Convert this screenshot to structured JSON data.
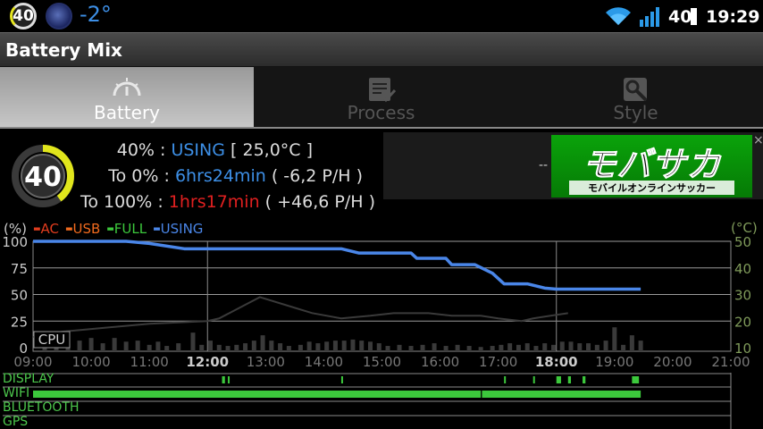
{
  "status_bar": {
    "battery_badge": "40",
    "temperature": "-2°",
    "battery_percent": "40",
    "clock": "19:29"
  },
  "app": {
    "title": "Battery Mix"
  },
  "tabs": [
    {
      "label": "Battery",
      "selected": true
    },
    {
      "label": "Process",
      "selected": false
    },
    {
      "label": "Style",
      "selected": false
    }
  ],
  "battery": {
    "gauge_value": "40",
    "level_fraction": 0.4,
    "line1": {
      "prefix": "40% : ",
      "value": "USING",
      "suffix": " [ 25,0°C ]"
    },
    "line2": {
      "prefix": "To 0% : ",
      "value": "6hrs24min",
      "suffix": " ( -6,2 P/H )"
    },
    "line3": {
      "prefix": "To 100% : ",
      "value": "1hrs17min",
      "suffix": " ( +46,6 P/H )"
    }
  },
  "ad": {
    "placeholder": "--",
    "title": "モバサカ",
    "subtitle": "モバイルオンラインサッカー",
    "close": "×"
  },
  "chart_data": {
    "type": "line",
    "left_unit": "(%)",
    "right_unit": "(°C)",
    "legend": [
      {
        "name": "AC",
        "color": "#e03c1e"
      },
      {
        "name": "USB",
        "color": "#f06a1e"
      },
      {
        "name": "FULL",
        "color": "#3cc83c"
      },
      {
        "name": "USING",
        "color": "#4a86e8"
      }
    ],
    "y_left_ticks": [
      "100",
      "75",
      "50",
      "25",
      "0"
    ],
    "y_left_range": [
      0,
      100
    ],
    "y_right_ticks": [
      "50",
      "40",
      "30",
      "20",
      "10"
    ],
    "y_right_range": [
      10,
      50
    ],
    "x_ticks": [
      "09:00",
      "10:00",
      "11:00",
      "12:00",
      "13:00",
      "14:00",
      "15:00",
      "16:00",
      "17:00",
      "18:00",
      "19:00",
      "20:00",
      "21:00"
    ],
    "x_bold_ticks": [
      "12:00",
      "18:00"
    ],
    "x_range_hours": [
      9,
      21
    ],
    "cpu_label": "CPU",
    "series": [
      {
        "name": "USING",
        "color": "#4a86e8",
        "points": [
          [
            9.0,
            100
          ],
          [
            10.6,
            100
          ],
          [
            11.0,
            98
          ],
          [
            11.6,
            93
          ],
          [
            14.3,
            93
          ],
          [
            14.6,
            89
          ],
          [
            15.5,
            89
          ],
          [
            15.6,
            84
          ],
          [
            16.1,
            84
          ],
          [
            16.2,
            78
          ],
          [
            16.6,
            78
          ],
          [
            16.9,
            70
          ],
          [
            17.1,
            60
          ],
          [
            17.5,
            60
          ],
          [
            17.8,
            56
          ],
          [
            18.0,
            55
          ],
          [
            19.45,
            55
          ]
        ]
      },
      {
        "name": "temperature",
        "color": "#3a3a3a",
        "points": [
          [
            9.0,
            14
          ],
          [
            9.5,
            16
          ],
          [
            10.0,
            17
          ],
          [
            11.0,
            19
          ],
          [
            12.0,
            20
          ],
          [
            12.2,
            21
          ],
          [
            12.9,
            29
          ],
          [
            13.5,
            25
          ],
          [
            13.8,
            23
          ],
          [
            14.3,
            21
          ],
          [
            14.8,
            22
          ],
          [
            15.2,
            23
          ],
          [
            15.8,
            23
          ],
          [
            16.2,
            22
          ],
          [
            16.7,
            22
          ],
          [
            17.0,
            21
          ],
          [
            17.4,
            20
          ],
          [
            17.6,
            21
          ],
          [
            17.9,
            22
          ],
          [
            18.2,
            23
          ]
        ]
      }
    ],
    "cpu_bars": [
      [
        9.2,
        25
      ],
      [
        9.4,
        10
      ],
      [
        9.6,
        15
      ],
      [
        9.8,
        20
      ],
      [
        10.0,
        25
      ],
      [
        10.2,
        15
      ],
      [
        10.4,
        25
      ],
      [
        10.6,
        18
      ],
      [
        10.8,
        20
      ],
      [
        11.0,
        12
      ],
      [
        11.15,
        18
      ],
      [
        11.3,
        10
      ],
      [
        11.5,
        15
      ],
      [
        11.75,
        35
      ],
      [
        11.9,
        12
      ],
      [
        12.05,
        20
      ],
      [
        12.2,
        12
      ],
      [
        12.35,
        10
      ],
      [
        12.5,
        12
      ],
      [
        12.65,
        15
      ],
      [
        12.8,
        20
      ],
      [
        12.95,
        30
      ],
      [
        13.1,
        20
      ],
      [
        13.25,
        15
      ],
      [
        13.4,
        10
      ],
      [
        13.6,
        12
      ],
      [
        13.75,
        18
      ],
      [
        13.9,
        15
      ],
      [
        14.05,
        18
      ],
      [
        14.2,
        20
      ],
      [
        14.35,
        20
      ],
      [
        14.5,
        22
      ],
      [
        14.65,
        20
      ],
      [
        14.8,
        18
      ],
      [
        14.95,
        15
      ],
      [
        15.1,
        10
      ],
      [
        15.3,
        12
      ],
      [
        15.5,
        10
      ],
      [
        15.7,
        12
      ],
      [
        15.9,
        15
      ],
      [
        16.1,
        10
      ],
      [
        16.3,
        12
      ],
      [
        16.5,
        10
      ],
      [
        16.7,
        8
      ],
      [
        16.9,
        10
      ],
      [
        17.05,
        12
      ],
      [
        17.2,
        15
      ],
      [
        17.35,
        12
      ],
      [
        17.5,
        15
      ],
      [
        17.65,
        10
      ],
      [
        17.8,
        15
      ],
      [
        17.95,
        12
      ],
      [
        18.1,
        18
      ],
      [
        18.25,
        18
      ],
      [
        18.4,
        15
      ],
      [
        18.55,
        15
      ],
      [
        18.7,
        12
      ],
      [
        18.85,
        20
      ],
      [
        19.0,
        45
      ],
      [
        19.15,
        12
      ],
      [
        19.3,
        30
      ],
      [
        19.45,
        20
      ]
    ]
  },
  "device_rows": [
    {
      "name": "DISPLAY",
      "segments": [
        [
          12.25,
          12.3
        ],
        [
          12.35,
          12.38
        ],
        [
          14.3,
          14.32
        ],
        [
          17.1,
          17.12
        ],
        [
          17.6,
          17.62
        ],
        [
          18.0,
          18.08
        ],
        [
          18.2,
          18.25
        ],
        [
          18.45,
          18.5
        ],
        [
          19.3,
          19.42
        ]
      ]
    },
    {
      "name": "WIFI",
      "segments": [
        [
          9.0,
          16.7
        ],
        [
          16.72,
          19.45
        ]
      ]
    },
    {
      "name": "BLUETOOTH",
      "segments": []
    },
    {
      "name": "GPS",
      "segments": []
    }
  ]
}
